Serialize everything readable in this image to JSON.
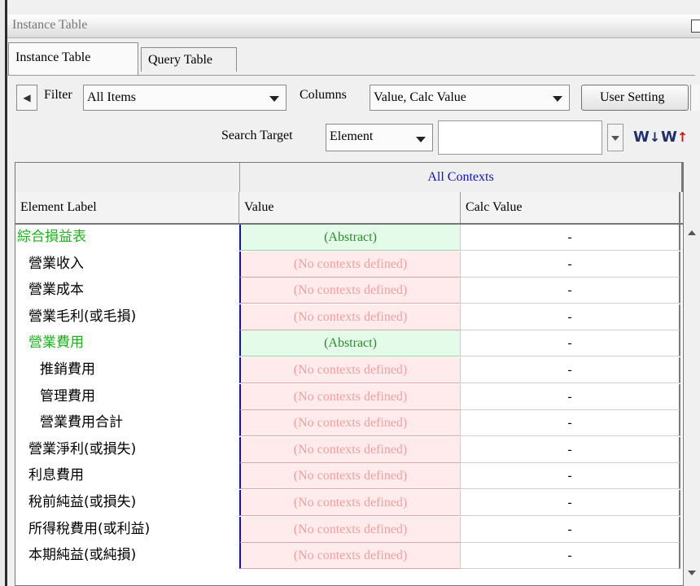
{
  "window": {
    "title": "Instance Table"
  },
  "tabs": [
    {
      "label": "Instance Table",
      "active": true
    },
    {
      "label": "Query Table",
      "active": false
    }
  ],
  "toolbar": {
    "filter_label": "Filter",
    "filter_value": "All Items",
    "columns_label": "Columns",
    "columns_value": "Value, Calc Value",
    "user_settings_label": "User Setting",
    "search_target_label": "Search Target",
    "search_target_value": "Element",
    "search_value": ""
  },
  "icons": {
    "sort_down": "sort-descending-icon",
    "sort_up": "sort-ascending-icon"
  },
  "colors": {
    "abstract_text": "#1db21d",
    "no_context_text": "#f0a0a0",
    "header_link": "#1010cc"
  },
  "table": {
    "group_header": "All Contexts",
    "columns": [
      "Element Label",
      "Value",
      "Calc Value"
    ],
    "rows": [
      {
        "label": "綜合損益表",
        "value": "(Abstract)",
        "calc": "-",
        "abstract": true,
        "indent": 0
      },
      {
        "label": "營業收入",
        "value": "(No contexts defined)",
        "calc": "-",
        "abstract": false,
        "indent": 1
      },
      {
        "label": "營業成本",
        "value": "(No contexts defined)",
        "calc": "-",
        "abstract": false,
        "indent": 1
      },
      {
        "label": "營業毛利(或毛損)",
        "value": "(No contexts defined)",
        "calc": "-",
        "abstract": false,
        "indent": 1
      },
      {
        "label": "營業費用",
        "value": "(Abstract)",
        "calc": "-",
        "abstract": true,
        "indent": 1
      },
      {
        "label": "推銷費用",
        "value": "(No contexts defined)",
        "calc": "-",
        "abstract": false,
        "indent": 2
      },
      {
        "label": "管理費用",
        "value": "(No contexts defined)",
        "calc": "-",
        "abstract": false,
        "indent": 2
      },
      {
        "label": "營業費用合計",
        "value": "(No contexts defined)",
        "calc": "-",
        "abstract": false,
        "indent": 2
      },
      {
        "label": "營業淨利(或損失)",
        "value": "(No contexts defined)",
        "calc": "-",
        "abstract": false,
        "indent": 1
      },
      {
        "label": "利息費用",
        "value": "(No contexts defined)",
        "calc": "-",
        "abstract": false,
        "indent": 1
      },
      {
        "label": "稅前純益(或損失)",
        "value": "(No contexts defined)",
        "calc": "-",
        "abstract": false,
        "indent": 1
      },
      {
        "label": "所得稅費用(或利益)",
        "value": "(No contexts defined)",
        "calc": "-",
        "abstract": false,
        "indent": 1
      },
      {
        "label": "本期純益(或純損)",
        "value": "(No contexts defined)",
        "calc": "-",
        "abstract": false,
        "indent": 1
      }
    ]
  }
}
